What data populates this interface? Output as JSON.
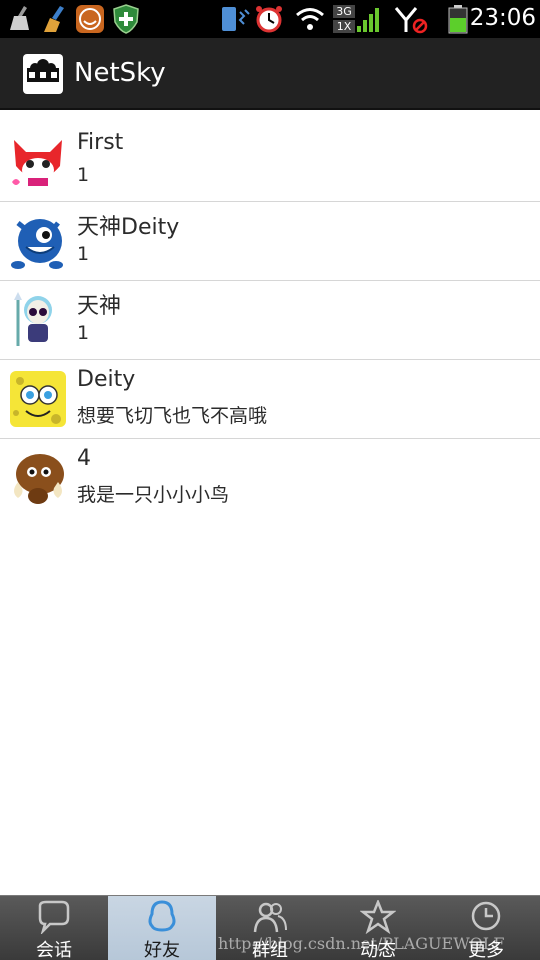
{
  "status_bar": {
    "time": "23:06",
    "network_label_top": "3G",
    "network_label_bottom": "1X",
    "icons": [
      "cleanup-icon",
      "broom-icon",
      "face-app-icon",
      "shield-plus-icon",
      "vibrate-icon",
      "alarm-icon",
      "wifi-icon",
      "signal-icon",
      "no-sim-icon",
      "battery-icon"
    ]
  },
  "action_bar": {
    "title": "NetSky",
    "logo_icon": "people-icon"
  },
  "friends": [
    {
      "name": "First",
      "subtitle": "1",
      "avatar_icon": "red-fox-avatar-icon"
    },
    {
      "name": "天神Deity",
      "subtitle": "1",
      "avatar_icon": "blue-monster-avatar-icon"
    },
    {
      "name": "天神",
      "subtitle": "1",
      "avatar_icon": "skeleton-avatar-icon"
    },
    {
      "name": "Deity",
      "subtitle": "想要飞切飞也飞不高哦",
      "avatar_icon": "sponge-avatar-icon"
    },
    {
      "name": "4",
      "subtitle": "我是一只小小小鸟",
      "avatar_icon": "mammoth-avatar-icon"
    }
  ],
  "tabs": [
    {
      "label": "会话",
      "icon": "chat-bubble-icon",
      "active": false
    },
    {
      "label": "好友",
      "icon": "penguin-icon",
      "active": true
    },
    {
      "label": "群组",
      "icon": "group-icon",
      "active": false
    },
    {
      "label": "动态",
      "icon": "star-icon",
      "active": false
    },
    {
      "label": "更多",
      "icon": "clock-icon",
      "active": false
    }
  ],
  "watermark": "http://blog.csdn.net/PLAGUEWOLF",
  "colors": {
    "status_bar_bg": "#000000",
    "action_bar_bg": "#222222",
    "tab_bar_bg": "#4a4a4a",
    "tab_active_bg": "#bccbdb",
    "divider": "#d6d6d6"
  }
}
